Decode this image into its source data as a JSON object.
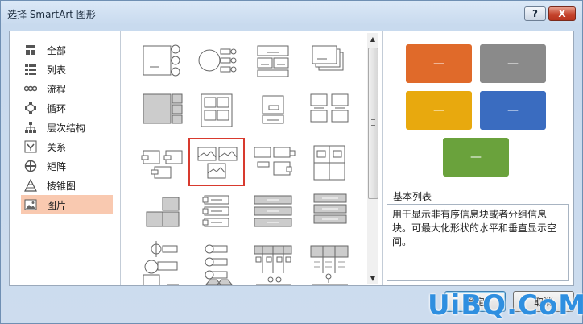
{
  "window": {
    "title": "选择 SmartArt 图形",
    "help_label": "?",
    "close_label": "X"
  },
  "categories": [
    {
      "label": "全部",
      "icon": "all-icon"
    },
    {
      "label": "列表",
      "icon": "list-icon"
    },
    {
      "label": "流程",
      "icon": "process-icon"
    },
    {
      "label": "循环",
      "icon": "cycle-icon"
    },
    {
      "label": "层次结构",
      "icon": "hierarchy-icon"
    },
    {
      "label": "关系",
      "icon": "relationship-icon"
    },
    {
      "label": "矩阵",
      "icon": "matrix-icon"
    },
    {
      "label": "棱锥图",
      "icon": "pyramid-icon"
    },
    {
      "label": "图片",
      "icon": "picture-icon"
    }
  ],
  "selected_category": "图片",
  "preview": {
    "colors": [
      "#e06a2a",
      "#8a8a8a",
      "#e8a90e",
      "#3a6cc0",
      "#6aa23c"
    ],
    "dash": "—"
  },
  "description": {
    "title": "基本列表",
    "text": "用于显示非有序信息块或者分组信息块。可最大化形状的水平和垂直显示空间。"
  },
  "buttons": {
    "ok": "确定",
    "cancel": "取消"
  },
  "watermark": "UiBQ.CoM"
}
